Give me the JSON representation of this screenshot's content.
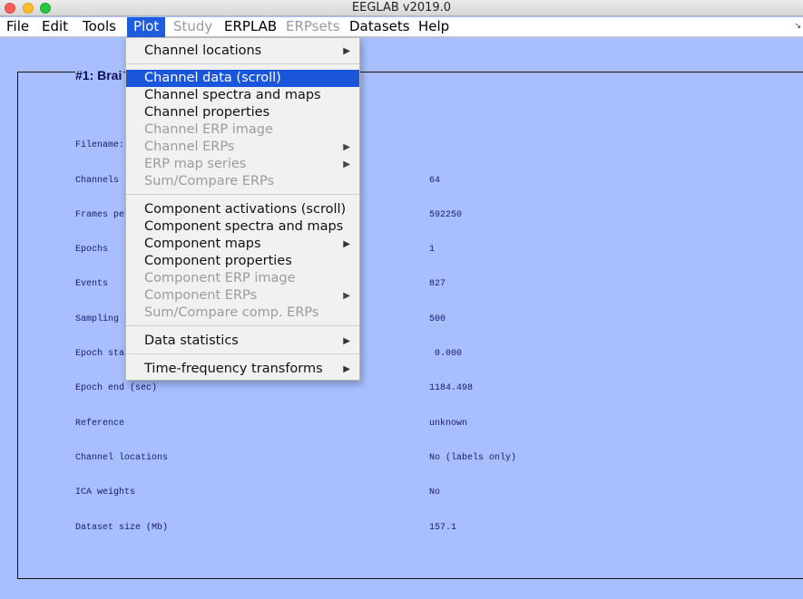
{
  "window": {
    "title": "EEGLAB v2019.0"
  },
  "menubar": {
    "items": [
      {
        "label": "File"
      },
      {
        "label": "Edit"
      },
      {
        "label": "Tools"
      },
      {
        "label": "Plot"
      },
      {
        "label": "Study"
      },
      {
        "label": "ERPLAB"
      },
      {
        "label": "ERPsets"
      },
      {
        "label": "Datasets"
      },
      {
        "label": "Help"
      }
    ],
    "active": "Plot",
    "disabled": [
      "Study",
      "ERPsets"
    ]
  },
  "plot_menu": {
    "items": [
      {
        "label": "Channel locations",
        "submenu": true,
        "enabled": true
      },
      {
        "label": "Channel data (scroll)",
        "submenu": false,
        "enabled": true,
        "highlighted": true
      },
      {
        "label": "Channel spectra and maps",
        "submenu": false,
        "enabled": true
      },
      {
        "label": "Channel properties",
        "submenu": false,
        "enabled": true
      },
      {
        "label": "Channel ERP image",
        "submenu": false,
        "enabled": false
      },
      {
        "label": "Channel ERPs",
        "submenu": true,
        "enabled": false
      },
      {
        "label": "ERP map series",
        "submenu": true,
        "enabled": false
      },
      {
        "label": "Sum/Compare ERPs",
        "submenu": false,
        "enabled": false
      },
      {
        "label": "Component activations (scroll)",
        "submenu": false,
        "enabled": true
      },
      {
        "label": "Component spectra and maps",
        "submenu": false,
        "enabled": true
      },
      {
        "label": "Component maps",
        "submenu": true,
        "enabled": true
      },
      {
        "label": "Component properties",
        "submenu": false,
        "enabled": true
      },
      {
        "label": "Component ERP image",
        "submenu": false,
        "enabled": false
      },
      {
        "label": "Component ERPs",
        "submenu": true,
        "enabled": false
      },
      {
        "label": "Sum/Compare comp. ERPs",
        "submenu": false,
        "enabled": false
      },
      {
        "label": "Data statistics",
        "submenu": true,
        "enabled": true
      },
      {
        "label": "Time-frequency transforms",
        "submenu": true,
        "enabled": true
      }
    ]
  },
  "dataset": {
    "title": "#1: Brai",
    "rows": [
      {
        "label": "Filename:",
        "value": ""
      },
      {
        "label": "Channels",
        "value": "64"
      },
      {
        "label": "Frames pe",
        "value": "592250"
      },
      {
        "label": "Epochs",
        "value": "1"
      },
      {
        "label": "Events",
        "value": "827"
      },
      {
        "label": "Sampling",
        "value": "500"
      },
      {
        "label": "Epoch sta",
        "value": " 0.000"
      },
      {
        "label": "Epoch end (sec)",
        "value": "1184.498"
      },
      {
        "label": "Reference",
        "value": "unknown"
      },
      {
        "label": "Channel locations",
        "value": "No (labels only)"
      },
      {
        "label": "ICA weights",
        "value": "No"
      },
      {
        "label": "Dataset size (Mb)",
        "value": "157.1"
      }
    ]
  },
  "colors": {
    "background": "#a8beff",
    "menu_highlight": "#1a56db",
    "text_dark_blue": "#1a1a6e"
  }
}
